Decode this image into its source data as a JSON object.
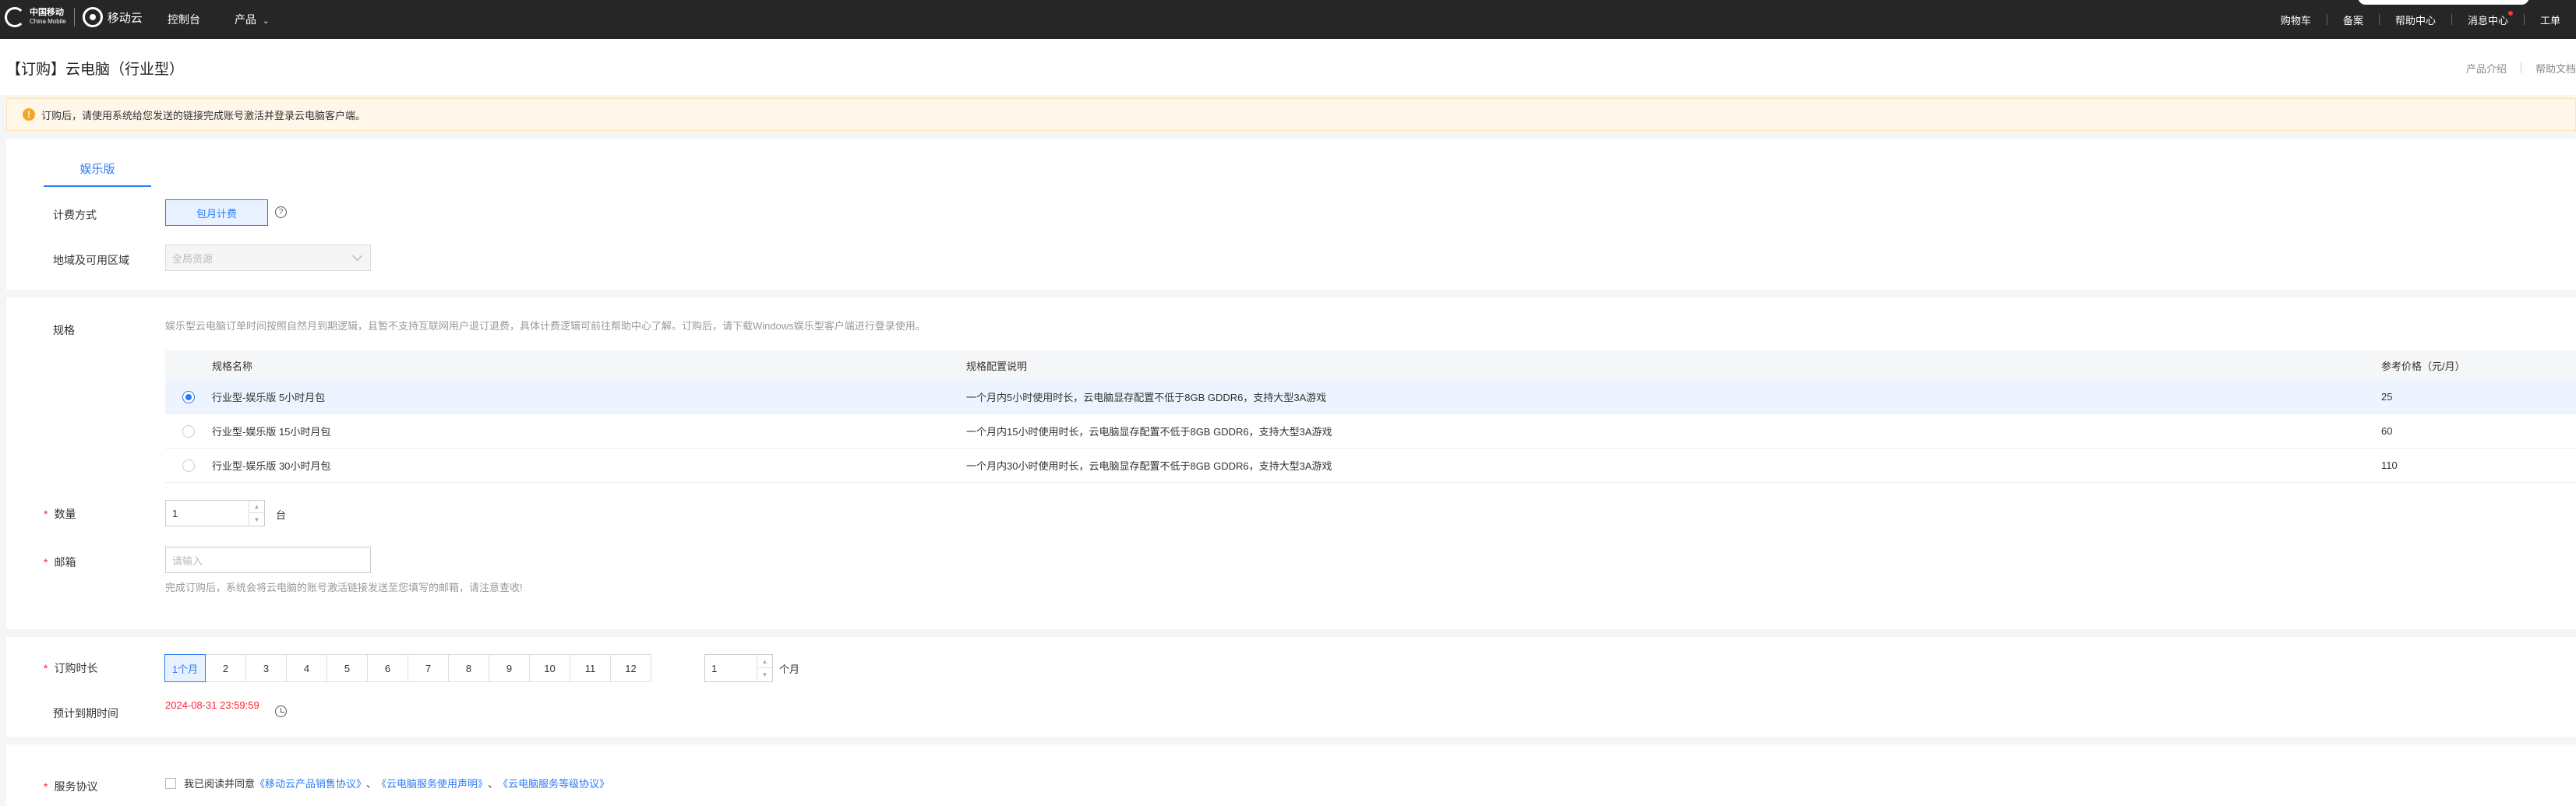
{
  "topbar": {
    "brand_cm": "中国移动",
    "brand_cm_sub": "China Mobile",
    "brand_yd": "移动云",
    "nav_left": [
      "控制台",
      "产品"
    ],
    "nav_right": [
      "购物车",
      "备案",
      "帮助中心",
      "消息中心",
      "工单"
    ]
  },
  "page": {
    "title": "【订购】云电脑（行业型）",
    "links": [
      "产品介绍",
      "帮助文档"
    ]
  },
  "alert": {
    "text": "订购后，请使用系统给您发送的链接完成账号激活并登录云电脑客户端。"
  },
  "config": {
    "tab": "娱乐版",
    "billing_label": "计费方式",
    "billing_value": "包月计费",
    "region_label": "地域及可用区域",
    "region_placeholder": "全局资源"
  },
  "spec": {
    "label": "规格",
    "hint": "娱乐型云电脑订单时间按照自然月到期逻辑，且暂不支持互联网用户退订退费，具体计费逻辑可前往帮助中心了解。订购后，请下载Windows娱乐型客户端进行登录使用。",
    "columns": [
      "规格名称",
      "规格配置说明",
      "参考价格（元/月）"
    ],
    "rows": [
      {
        "name": "行业型-娱乐版 5小时月包",
        "desc": "一个月内5小时使用时长，云电脑显存配置不低于8GB GDDR6，支持大型3A游戏",
        "price": "25",
        "selected": true
      },
      {
        "name": "行业型-娱乐版 15小时月包",
        "desc": "一个月内15小时使用时长，云电脑显存配置不低于8GB GDDR6，支持大型3A游戏",
        "price": "60",
        "selected": false
      },
      {
        "name": "行业型-娱乐版 30小时月包",
        "desc": "一个月内30小时使用时长，云电脑显存配置不低于8GB GDDR6，支持大型3A游戏",
        "price": "110",
        "selected": false
      }
    ],
    "quantity_label": "数量",
    "quantity_value": "1",
    "quantity_unit": "台",
    "email_label": "邮箱",
    "email_placeholder": "请输入",
    "email_hint": "完成订购后，系统会将云电脑的账号激活链接发送至您填写的邮箱，请注意查收!"
  },
  "duration": {
    "label": "订购时长",
    "options": [
      "1个月",
      "2",
      "3",
      "4",
      "5",
      "6",
      "7",
      "8",
      "9",
      "10",
      "11",
      "12"
    ],
    "selected_index": 0,
    "custom_value": "1",
    "custom_unit": "个月",
    "expire_label": "预计到期时间",
    "expire_value": "2024-08-31 23:59:59"
  },
  "agreement": {
    "label": "服务协议",
    "prefix": "我已阅读并同意",
    "link1": "《移动云产品销售协议》",
    "sep1": "、",
    "link2": "《云电脑服务使用声明》",
    "sep2": "、",
    "link3": "《云电脑服务等级协议》"
  }
}
